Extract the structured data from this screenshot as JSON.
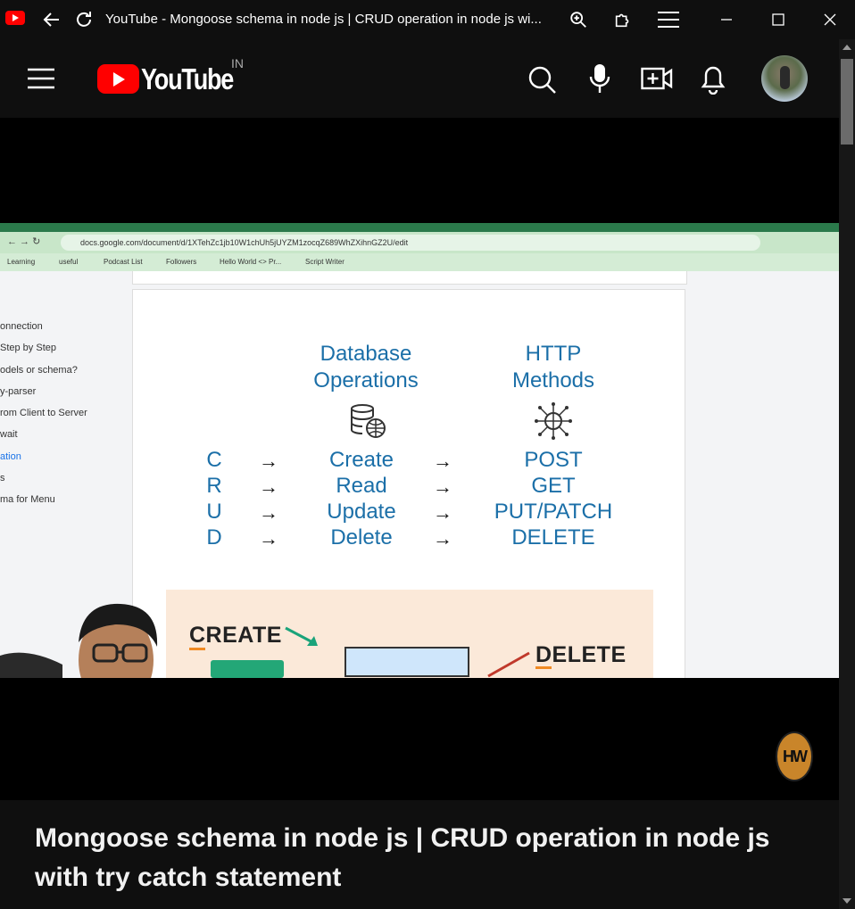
{
  "window": {
    "title": "YouTube - Mongoose schema in node js | CRUD operation in node js wi..."
  },
  "header": {
    "logo_text": "YouTube",
    "region": "IN"
  },
  "browser_in_video": {
    "url": "docs.google.com/document/d/1XTehZc1jb10W1chUh5jUYZM1zocqZ689WhZXihnGZ2U/edit",
    "bookmarks": [
      "Learning",
      "useful",
      "Podcast List",
      "Followers",
      "Hello World <> Pr...",
      "Script Writer"
    ],
    "outline": [
      "onnection",
      "Step by Step",
      "odels or schema?",
      "y-parser",
      "rom Client to Server",
      "wait",
      "ation",
      "s",
      "ma for Menu"
    ],
    "outline_active_index": 6
  },
  "slide": {
    "db_heading": "Database\nOperations",
    "http_heading": "HTTP\nMethods",
    "arrow": "→",
    "rows": [
      {
        "letter": "C",
        "op": "Create",
        "method": "POST"
      },
      {
        "letter": "R",
        "op": "Read",
        "method": "GET"
      },
      {
        "letter": "U",
        "op": "Update",
        "method": "PUT/PATCH"
      },
      {
        "letter": "D",
        "op": "Delete",
        "method": "DELETE"
      }
    ],
    "create_label": "CREATE",
    "delete_label": "DELETE"
  },
  "channel_badge": "HW",
  "video_title": "Mongoose schema in node js | CRUD operation in node js with try catch statement",
  "colors": {
    "youtube_red": "#ff0000",
    "slide_blue": "#1b6fa8",
    "background": "#0f0f0f"
  }
}
